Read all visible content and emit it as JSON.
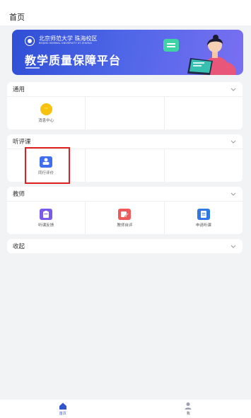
{
  "header": {
    "title": "首页"
  },
  "banner": {
    "school_name": "北京师范大学 珠海校区",
    "school_name_en": "BEIJING NORMAL UNIVERSITY AT ZHUHAI",
    "platform_title": "教学质量保障平台"
  },
  "sections": [
    {
      "title": "通用",
      "items": [
        {
          "label": "消息中心",
          "icon": "chat-dots-icon",
          "color": "#f7c20d"
        }
      ]
    },
    {
      "title": "听评课",
      "items": [
        {
          "label": "同行评价",
          "icon": "peer-review-icon",
          "color": "#3f6ff0"
        }
      ]
    },
    {
      "title": "教师",
      "items": [
        {
          "label": "听课反馈",
          "icon": "clipboard-icon",
          "color": "#7a5ae8"
        },
        {
          "label": "教师自评",
          "icon": "edit-icon",
          "color": "#ee5a5a"
        },
        {
          "label": "申请听课",
          "icon": "document-icon",
          "color": "#2f78e6"
        }
      ]
    },
    {
      "title": "收起",
      "items": []
    }
  ],
  "tabbar": {
    "items": [
      {
        "label": "首页",
        "icon": "home-icon",
        "active": true
      },
      {
        "label": "我",
        "icon": "user-icon",
        "active": false
      }
    ]
  },
  "colors": {
    "accent": "#3355cc",
    "highlight": "#e02020"
  }
}
